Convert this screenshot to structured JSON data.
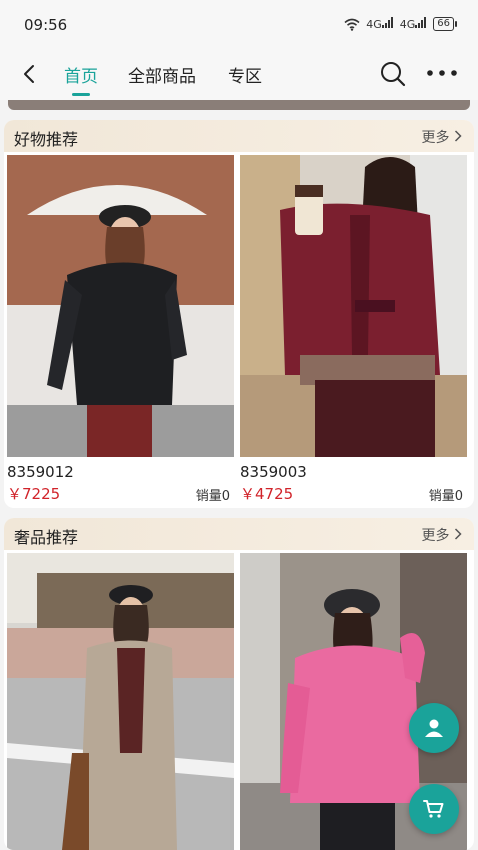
{
  "status": {
    "time": "09:56",
    "signal_1": "4G",
    "signal_2": "4G",
    "battery": "66"
  },
  "nav": {
    "tabs": [
      {
        "label": "首页",
        "active": true
      },
      {
        "label": "全部商品",
        "active": false
      },
      {
        "label": "专区",
        "active": false
      }
    ],
    "icons": [
      "back-arrow-icon",
      "search-icon",
      "more-dots-icon"
    ]
  },
  "sections": [
    {
      "title": "好物推荐",
      "more_label": "更多",
      "products": [
        {
          "code": "8359012",
          "price": "￥7225",
          "sales": "销量0"
        },
        {
          "code": "8359003",
          "price": "￥4725",
          "sales": "销量0"
        }
      ]
    },
    {
      "title": "奢品推荐",
      "more_label": "更多",
      "products": [
        {
          "code": "",
          "price": "",
          "sales": ""
        },
        {
          "code": "",
          "price": "",
          "sales": ""
        }
      ]
    }
  ],
  "fabs": [
    "user-icon",
    "cart-icon"
  ],
  "colors": {
    "accent": "#1aa39a",
    "price": "#d1232a",
    "section_header": "#f1e7d8"
  }
}
